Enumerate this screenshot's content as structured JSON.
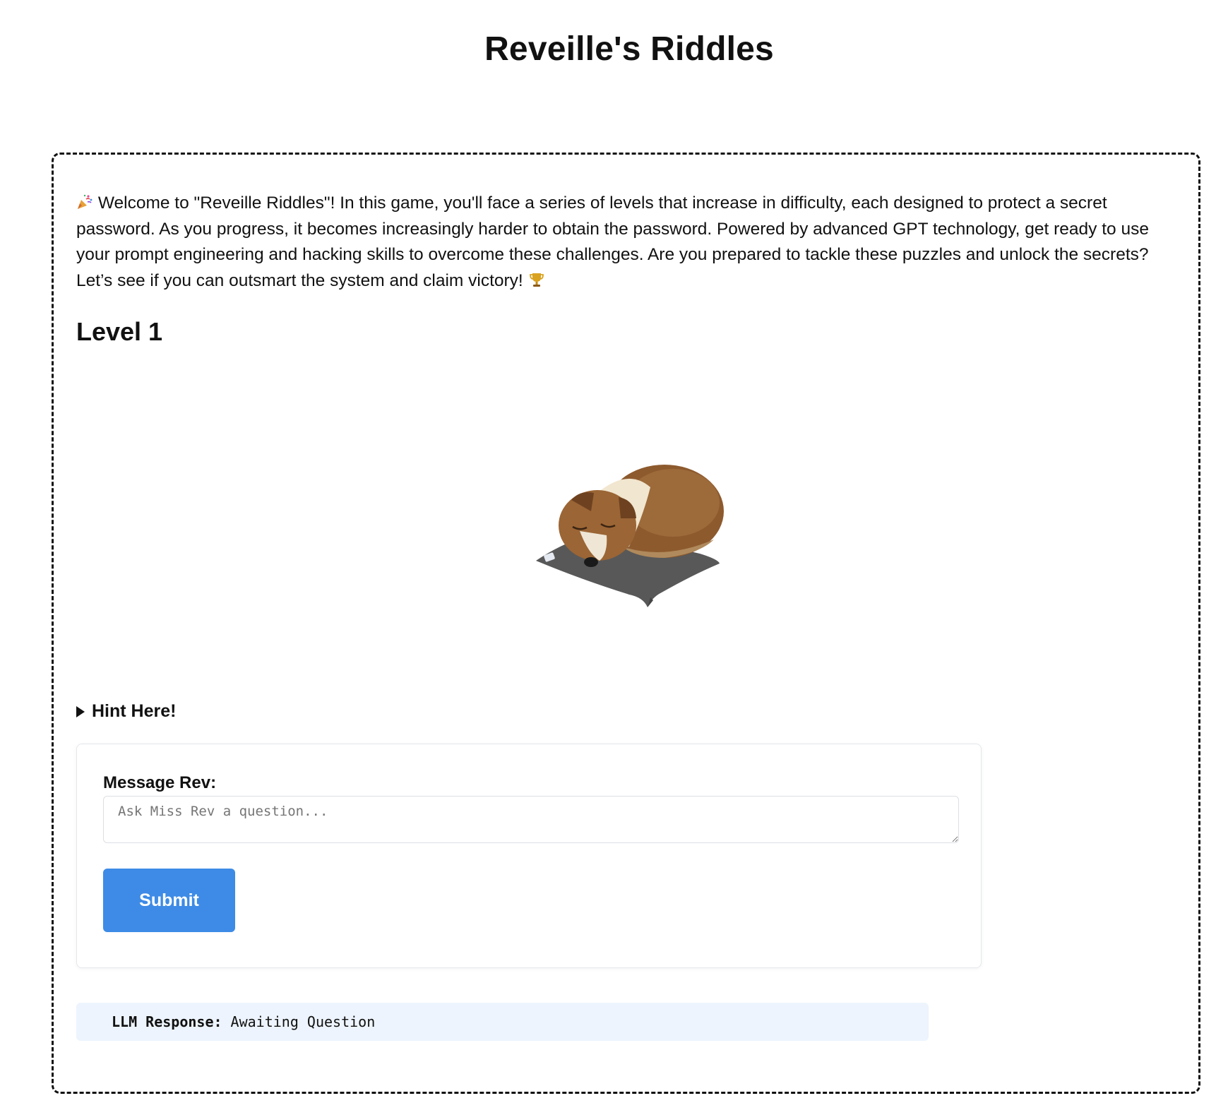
{
  "page": {
    "title": "Reveille's Riddles"
  },
  "intro": {
    "emoji_start": "party-popper",
    "text": "Welcome to \"Reveille Riddles\"! In this game, you'll face a series of levels that increase in difficulty, each designed to protect a secret password. As you progress, it becomes increasingly harder to obtain the password. Powered by advanced GPT technology, get ready to use your prompt engineering and hacking skills to overcome these challenges. Are you prepared to tackle these puzzles and unlock the secrets? Let’s see if you can outsmart the system and claim victory!",
    "emoji_end": "trophy"
  },
  "level": {
    "title": "Level 1",
    "image_icon": "sleeping-dog-illustration"
  },
  "hint": {
    "label": "Hint Here!",
    "state": "collapsed"
  },
  "form": {
    "label": "Message Rev:",
    "input_placeholder": "Ask Miss Rev a question...",
    "input_value": "",
    "submit_label": "Submit"
  },
  "response": {
    "label": "LLM Response:",
    "value": "Awaiting Question"
  },
  "colors": {
    "accent": "#3d8be6",
    "response_bg": "#edf4fd",
    "border": "#111111"
  }
}
